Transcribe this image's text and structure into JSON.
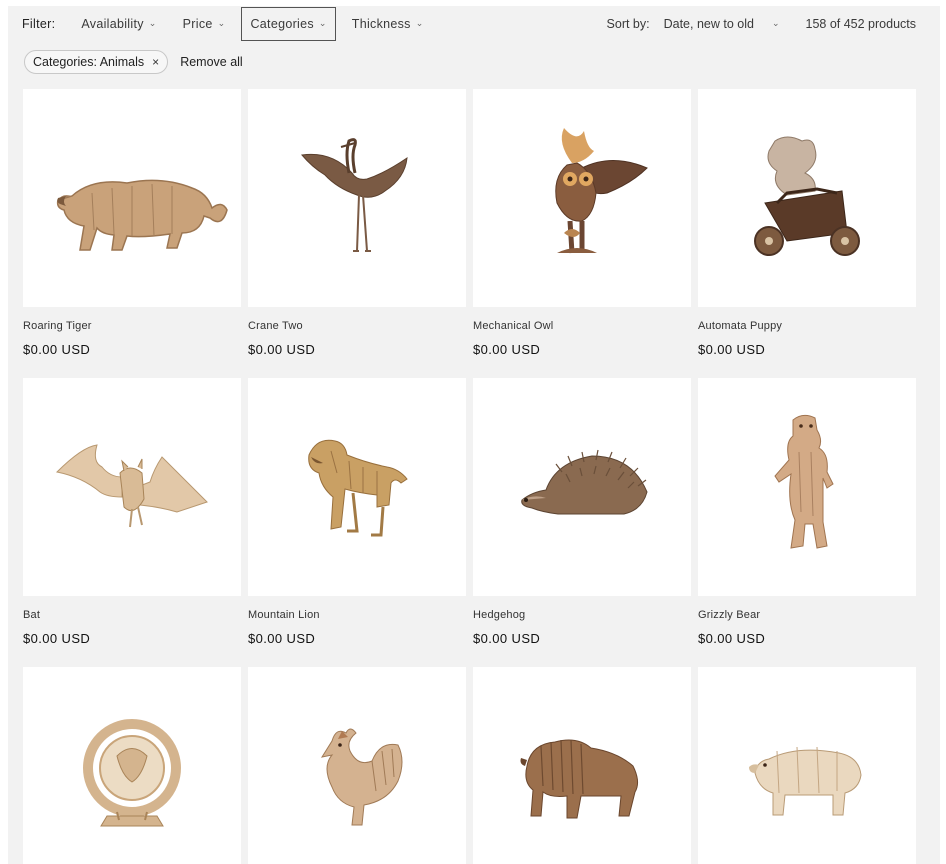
{
  "filters": {
    "label": "Filter:",
    "items": [
      {
        "label": "Availability",
        "active": false
      },
      {
        "label": "Price",
        "active": false
      },
      {
        "label": "Categories",
        "active": true
      },
      {
        "label": "Thickness",
        "active": false
      }
    ]
  },
  "sort": {
    "label": "Sort by:",
    "value": "Date, new to old"
  },
  "count": "158 of 452 products",
  "active_facets": {
    "pill": "Categories: Animals",
    "remove_all": "Remove all"
  },
  "icons": {
    "chevron": "chevron-down-icon",
    "close": "close-icon"
  },
  "colors": {
    "background": "#f2f2f2",
    "card": "#ffffff",
    "wood_light": "#d9b994",
    "wood_mid": "#b88c62",
    "wood_dark": "#6b4632"
  },
  "products": [
    {
      "title": "Roaring Tiger",
      "price": "$0.00 USD"
    },
    {
      "title": "Crane Two",
      "price": "$0.00 USD"
    },
    {
      "title": "Mechanical Owl",
      "price": "$0.00 USD"
    },
    {
      "title": "Automata Puppy",
      "price": "$0.00 USD"
    },
    {
      "title": "Bat",
      "price": "$0.00 USD"
    },
    {
      "title": "Mountain Lion",
      "price": "$0.00 USD"
    },
    {
      "title": "Hedgehog",
      "price": "$0.00 USD"
    },
    {
      "title": "Grizzly Bear",
      "price": "$0.00 USD"
    },
    {
      "title": "",
      "price": ""
    },
    {
      "title": "",
      "price": ""
    },
    {
      "title": "",
      "price": ""
    },
    {
      "title": "",
      "price": ""
    }
  ]
}
